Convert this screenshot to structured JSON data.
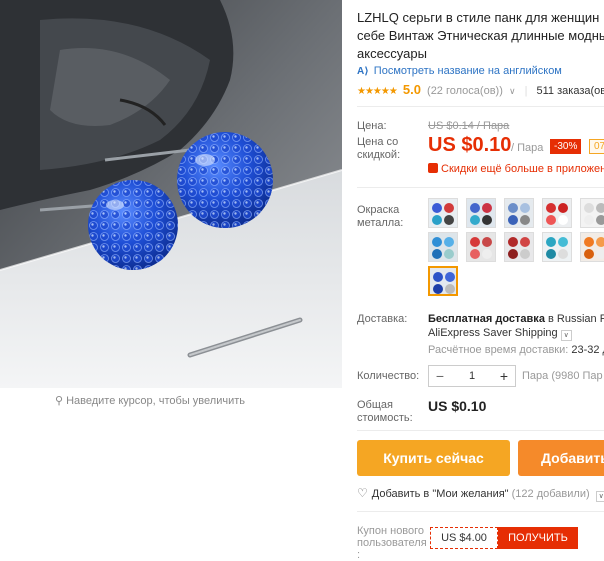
{
  "product": {
    "title_lines": [
      "LZHLQ серьги в стиле панк для женщин B",
      "себе Винтаж Этническая длинные модны",
      "аксессуары"
    ],
    "translate_link": "Посмотреть название на английском",
    "rating": {
      "stars": "★★★★★",
      "score": "5.0",
      "votes": "(22 голоса(ов))",
      "orders": "511 заказа(ов"
    }
  },
  "zoom_hint": "Наведите курсор, чтобы увеличить",
  "price": {
    "label": "Цена:",
    "old": "US $0.14 / Пара",
    "discount_label": "Цена со скидкой:",
    "new": "US $0.10",
    "unit": "/ Пара",
    "discount_badge": "-30%",
    "badge2": "07",
    "more_discounts": "Скидки ещё больше в приложен"
  },
  "color": {
    "label": "Окраска металла:",
    "swatches": [
      {
        "bg": "#e9eef2",
        "dots": [
          "#3b5bd6",
          "#d23b3b",
          "#2aa0c8",
          "#444"
        ]
      },
      {
        "bg": "#dfe7ee",
        "dots": [
          "#4466cc",
          "#cc3344",
          "#33aacc",
          "#333"
        ]
      },
      {
        "bg": "#e5eaee",
        "dots": [
          "#6b8ec9",
          "#a7c0e0",
          "#3a62b8",
          "#888"
        ]
      },
      {
        "bg": "#eceef0",
        "dots": [
          "#d63030",
          "#c22",
          "#e55",
          "#fff"
        ]
      },
      {
        "bg": "#f3f3f3",
        "dots": [
          "#ddd",
          "#bbb",
          "#eee",
          "#999"
        ]
      },
      {
        "bg": "#dde5ea",
        "dots": [
          "#2f8fd6",
          "#56b0e8",
          "#1e70b8",
          "#9cc"
        ]
      },
      {
        "bg": "#e6e6e6",
        "dots": [
          "#d63a3a",
          "#c84848",
          "#e76060",
          "#eee"
        ]
      },
      {
        "bg": "#e8e8ea",
        "dots": [
          "#b12a2a",
          "#d14545",
          "#8e1f1f",
          "#ccc"
        ]
      },
      {
        "bg": "#eef2f4",
        "dots": [
          "#2ba6c2",
          "#44bcd6",
          "#1e8aa4",
          "#ddd"
        ]
      },
      {
        "bg": "#f2ece6",
        "dots": [
          "#f07a22",
          "#f59b4a",
          "#d8610f",
          "#eee"
        ]
      },
      {
        "bg": "#e3e8ef",
        "dots": [
          "#2c52c7",
          "#3f66d9",
          "#1d3ea8",
          "#bbb"
        ]
      }
    ]
  },
  "shipping": {
    "label": "Доставка:",
    "main_bold": "Бесплатная доставка",
    "main_rest": " в Russian Fe",
    "method": "AliExpress Saver Shipping",
    "time_label": "Расчётное время доставки:",
    "time_value": " 23-32 д"
  },
  "quantity": {
    "label": "Количество:",
    "value": "1",
    "info": "Пара (9980 Пар"
  },
  "total": {
    "label": "Общая стоимость:",
    "value": "US $0.10"
  },
  "buttons": {
    "buy_now": "Купить сейчас",
    "add_to_cart": "Добавить"
  },
  "wishlist": {
    "text": "Добавить в \"Мои желания\"",
    "count": "(122 добавили)"
  },
  "coupon": {
    "label": "Купон нового пользователя :",
    "value": "US $4.00",
    "button": "ПОЛУЧИТЬ"
  }
}
